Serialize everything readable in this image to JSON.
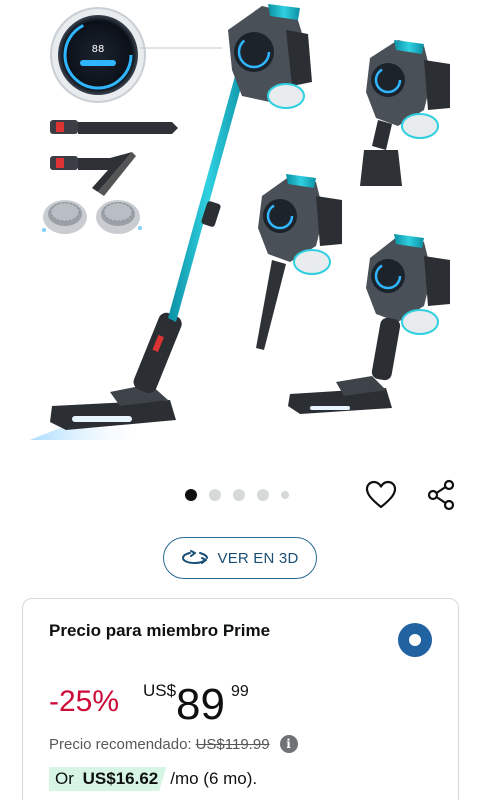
{
  "product": {
    "image_alt": "Aspiradora inalámbrica"
  },
  "carousel": {
    "total_dots": 5,
    "active_index": 0
  },
  "actions": {
    "wishlist_icon": "heart-outline-icon",
    "share_icon": "share-icon"
  },
  "view3d": {
    "icon": "rotate-3d-icon",
    "label": "VER EN 3D"
  },
  "price_card": {
    "title": "Precio para miembro Prime",
    "discount": "-25%",
    "currency": "US$",
    "price_whole": "89",
    "price_fraction": "99",
    "list_price_label": "Precio recomendado:",
    "list_price": "US$119.99",
    "info_icon": "info-icon",
    "installment_prefix": "Or",
    "installment_amount": "US$16.62",
    "installment_suffix": "/mo (6 mo).",
    "radio_selected": true
  },
  "colors": {
    "discount": "#cc0c39",
    "accent_blue": "#2162a1",
    "installment_bg": "#d7f5e4",
    "vacuum_teal": "#1fb6c9"
  }
}
